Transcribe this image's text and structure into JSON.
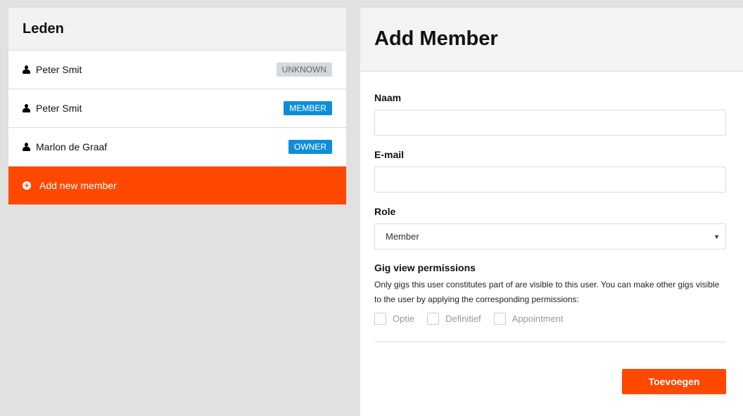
{
  "members_panel": {
    "title": "Leden",
    "items": [
      {
        "name": "Peter Smit",
        "role": "UNKNOWN"
      },
      {
        "name": "Peter Smit",
        "role": "MEMBER"
      },
      {
        "name": "Marlon de Graaf",
        "role": "OWNER"
      }
    ],
    "add_label": "Add new member"
  },
  "form": {
    "title": "Add Member",
    "name_label": "Naam",
    "name_value": "",
    "email_label": "E-mail",
    "email_value": "",
    "role_label": "Role",
    "role_value": "Member",
    "permissions_title": "Gig view permissions",
    "permissions_desc": "Only gigs this user constitutes part of are visible to this user. You can make other gigs visible to the user by applying the corresponding permissions:",
    "permissions": [
      {
        "label": "Optie",
        "checked": false
      },
      {
        "label": "Definitief",
        "checked": false
      },
      {
        "label": "Appointment",
        "checked": false
      }
    ],
    "submit_label": "Toevoegen"
  },
  "colors": {
    "accent": "#ff4800",
    "badge_blue": "#0e8ed8",
    "badge_gray": "#d4d9de"
  }
}
